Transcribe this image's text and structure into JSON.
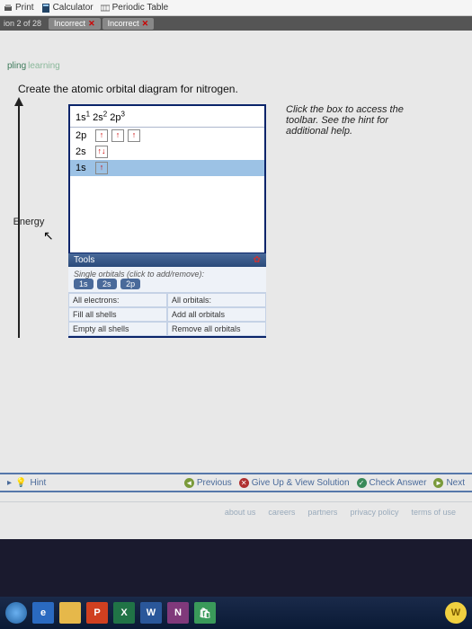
{
  "topbar": {
    "print": "Print",
    "calculator": "Calculator",
    "periodic": "Periodic Table"
  },
  "status": {
    "question": "ion 2 of 28",
    "a1": "Incorrect",
    "a2": "Incorrect"
  },
  "brand": {
    "p1": "pling",
    "p2": "learning"
  },
  "prompt": "Create the atomic orbital diagram for nitrogen.",
  "energy_label": "Energy",
  "config_html": "1s¹ 2s² 2p³",
  "orbitals": {
    "r2p": "2p",
    "r2s": "2s",
    "r1s": "1s"
  },
  "tools": {
    "header": "Tools",
    "single": "Single orbitals (click to add/remove):",
    "p1s": "1s",
    "p2s": "2s",
    "p2p": "2p",
    "ae": "All electrons:",
    "ao": "All orbitals:",
    "fill": "Fill all shells",
    "add": "Add all orbitals",
    "empty": "Empty all shells",
    "remove": "Remove all orbitals"
  },
  "hint_text": "Click the box to access the toolbar. See the hint for additional help.",
  "bottom": {
    "hint": "Hint",
    "prev": "Previous",
    "give": "Give Up & View Solution",
    "check": "Check Answer",
    "next": "Next"
  },
  "footer": {
    "about": "about us",
    "careers": "careers",
    "partners": "partners",
    "privacy": "privacy policy",
    "terms": "terms of use"
  },
  "taskbar": {
    "p": "P",
    "x": "X",
    "w": "W",
    "n": "N",
    "badge": "W"
  }
}
